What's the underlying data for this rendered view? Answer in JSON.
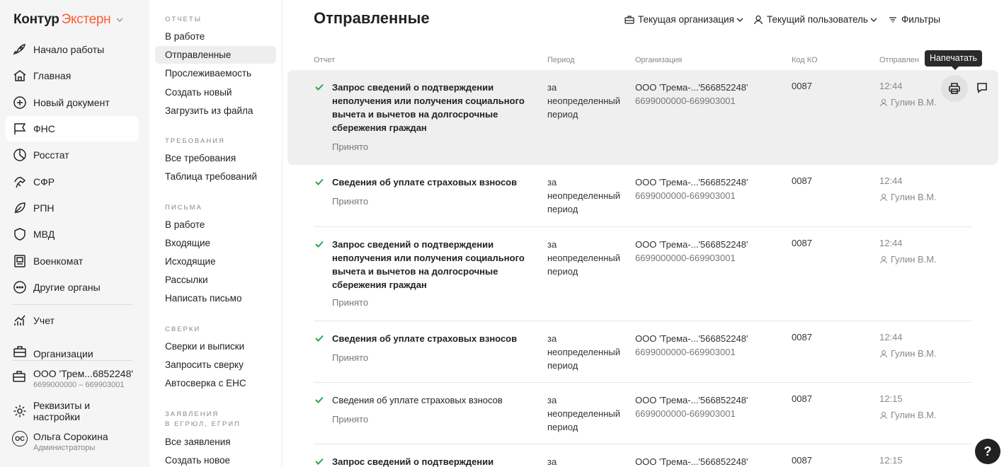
{
  "app": {
    "logo_main": "Контур",
    "logo_accent": "Экстерн"
  },
  "sidebar": {
    "items": [
      {
        "label": "Начало работы",
        "icon": "rocket-icon"
      },
      {
        "label": "Главная",
        "icon": "home-icon"
      },
      {
        "label": "Новый документ",
        "icon": "plus-circle-icon"
      },
      {
        "label": "ФНС",
        "icon": "flag-icon"
      },
      {
        "label": "Росстат",
        "icon": "pie-chart-icon"
      },
      {
        "label": "СФР",
        "icon": "hands-icon"
      },
      {
        "label": "РПН",
        "icon": "leaf-icon"
      },
      {
        "label": "МВД",
        "icon": "shield-icon"
      },
      {
        "label": "Военкомат",
        "icon": "id-card-icon"
      },
      {
        "label": "Другие органы",
        "icon": "more-circle-icon"
      },
      {
        "label": "Учет",
        "icon": "chart-icon"
      },
      {
        "label": "Организации",
        "icon": "briefcase-icon"
      }
    ],
    "org": {
      "name": "ООО 'Трем...6852248'",
      "sub": "6699000000 – 669903001"
    },
    "settings": "Реквизиты и настройки",
    "user": {
      "initials": "ОС",
      "name": "Ольга Сорокина",
      "role": "Администраторы"
    }
  },
  "submenu": {
    "s1": "ОТЧЕТЫ",
    "s1_items": [
      "В работе",
      "Отправленные",
      "Прослеживаемость",
      "Создать новый",
      "Загрузить из файла"
    ],
    "s2": "ТРЕБОВАНИЯ",
    "s2_items": [
      "Все требования",
      "Таблица требований"
    ],
    "s3": "ПИСЬМА",
    "s3_items": [
      "В работе",
      "Входящие",
      "Исходящие",
      "Рассылки",
      "Написать письмо"
    ],
    "s4": "СВЕРКИ",
    "s4_items": [
      "Сверки и выписки",
      "Запросить сверку",
      "Автосверка с ЕНС"
    ],
    "s5a": "ЗАЯВЛЕНИЯ",
    "s5b": "В ЕГРЮЛ, ЕГРИП",
    "s5_items": [
      "Все заявления",
      "Создать новое"
    ]
  },
  "main": {
    "title": "Отправленные",
    "filter_org": "Текущая организация",
    "filter_user": "Текущий пользователь",
    "filters": "Фильтры",
    "tooltip": "Напечатать",
    "help": "?",
    "columns": {
      "report": "Отчет",
      "period": "Период",
      "org": "Организация",
      "code": "Код КО",
      "sent": "Отправлен"
    },
    "rows": [
      {
        "l1": "Запрос сведений о подтверждении",
        "l2": "неполучения или получения социального",
        "l3": "вычета и вычетов на долгосрочные",
        "l4": "сбережения граждан",
        "status": "Принято",
        "p1": "за",
        "p2": "неопределенный",
        "p3": "период",
        "org": "ООО 'Трема-...'566852248'",
        "inn": "6699000000-669903001",
        "code": "0087",
        "time": "12:44",
        "user": "Гулин В.М."
      },
      {
        "l1": "Сведения об уплате страховых взносов",
        "status": "Принято",
        "p1": "за",
        "p2": "неопределенный",
        "p3": "период",
        "org": "ООО 'Трема-...'566852248'",
        "inn": "6699000000-669903001",
        "code": "0087",
        "time": "12:44",
        "user": "Гулин В.М."
      },
      {
        "l1": "Запрос сведений о подтверждении",
        "l2": "неполучения или получения социального",
        "l3": "вычета и вычетов на долгосрочные",
        "l4": "сбережения граждан",
        "status": "Принято",
        "p1": "за",
        "p2": "неопределенный",
        "p3": "период",
        "org": "ООО 'Трема-...'566852248'",
        "inn": "6699000000-669903001",
        "code": "0087",
        "time": "12:44",
        "user": "Гулин В.М."
      },
      {
        "l1": "Сведения об уплате страховых взносов",
        "status": "Принято",
        "p1": "за",
        "p2": "неопределенный",
        "p3": "период",
        "org": "ООО 'Трема-...'566852248'",
        "inn": "6699000000-669903001",
        "code": "0087",
        "time": "12:44",
        "user": "Гулин В.М."
      },
      {
        "l1": "Сведения об уплате страховых взносов",
        "status": "Принято",
        "p1": "за",
        "p2": "неопределенный",
        "p3": "период",
        "org": "ООО 'Трема-...'566852248'",
        "inn": "6699000000-669903001",
        "code": "0087",
        "time": "12:15",
        "user": "Гулин В.М."
      },
      {
        "l1": "Запрос сведений о подтверждении",
        "p1": "за",
        "org": "ООО 'Трема-...'566852248'",
        "code": "0087",
        "time": "12:15"
      }
    ]
  },
  "colors": {
    "accent": "#ff5a34",
    "check": "#2aa84a",
    "sidebar_bg": "#f5f5f5"
  }
}
